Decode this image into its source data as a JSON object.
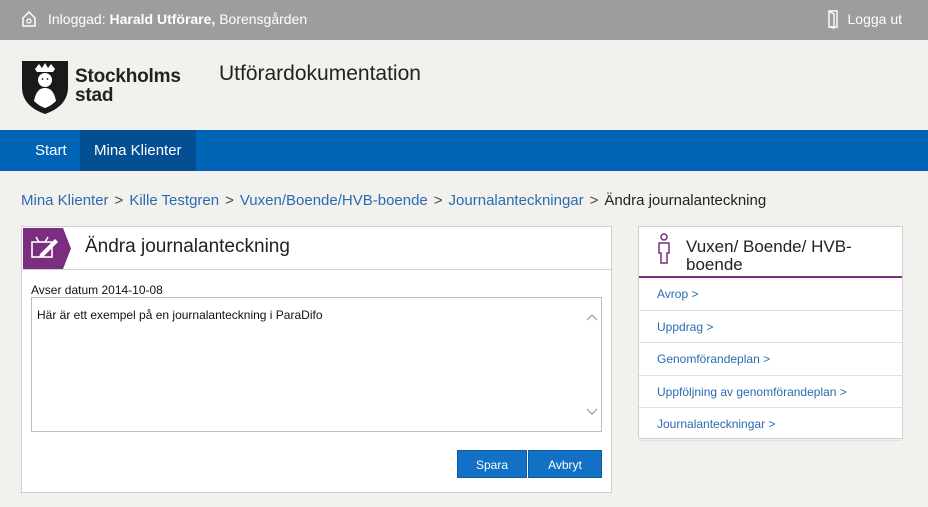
{
  "topbar": {
    "logged_in_prefix": "Inloggad:",
    "user_name": "Harald Utförare,",
    "unit": "Borensgården",
    "logout_label": "Logga ut"
  },
  "header": {
    "logo_line1": "Stockholms",
    "logo_line2": "stad",
    "app_title": "Utförardokumentation"
  },
  "nav": {
    "items": [
      {
        "label": "Start"
      },
      {
        "label": "Mina Klienter",
        "active": true
      }
    ]
  },
  "breadcrumb": {
    "items": [
      "Mina Klienter",
      "Kille Testgren",
      "Vuxen/Boende/HVB-boende",
      "Journalanteckningar"
    ],
    "current": "Ändra journalanteckning",
    "separator": ">"
  },
  "main_panel": {
    "title": "Ändra journalanteckning",
    "date_label": "Avser datum 2014-10-08",
    "note_text": "Här är ett exempel på en journalanteckning i ParaDifo",
    "save_label": "Spara",
    "cancel_label": "Avbryt"
  },
  "side_panel": {
    "title_line1": "Vuxen/ Boende/ HVB-",
    "title_line2": "boende",
    "links": [
      {
        "label": "Avrop >"
      },
      {
        "label": "Uppdrag >"
      },
      {
        "label": "Genomförandeplan >"
      },
      {
        "label": "Uppföljning av genomförandeplan >"
      },
      {
        "label": "Journalanteckningar >"
      }
    ]
  },
  "colors": {
    "topbar": "#9d9d9d",
    "nav": "#0064b6",
    "nav_active": "#044e94",
    "accent_purple": "#7b2e7f",
    "link": "#2a6bb0",
    "button": "#1271c4"
  }
}
